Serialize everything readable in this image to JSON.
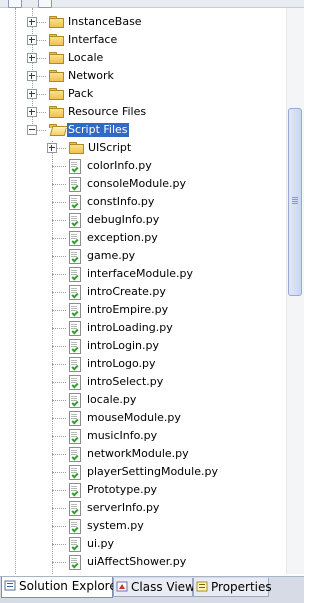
{
  "tree": {
    "folders_collapsed": [
      "InstanceBase",
      "Interface",
      "Locale",
      "Network",
      "Pack",
      "Resource Files"
    ],
    "open_folder": "Script Files",
    "subfolder": "UIScript",
    "files": [
      "colorInfo.py",
      "consoleModule.py",
      "constInfo.py",
      "debugInfo.py",
      "exception.py",
      "game.py",
      "interfaceModule.py",
      "introCreate.py",
      "introEmpire.py",
      "introLoading.py",
      "introLogin.py",
      "introLogo.py",
      "introSelect.py",
      "locale.py",
      "mouseModule.py",
      "musicInfo.py",
      "networkModule.py",
      "playerSettingModule.py",
      "Prototype.py",
      "serverInfo.py",
      "system.py",
      "ui.py",
      "uiAffectShower.py"
    ]
  },
  "tabs": {
    "solution_explorer": "Solution Explorer",
    "class_view": "Class View",
    "properties": "Properties"
  },
  "colors": {
    "selection": "#316ac5",
    "tab_bg": "#d6dbe6"
  }
}
